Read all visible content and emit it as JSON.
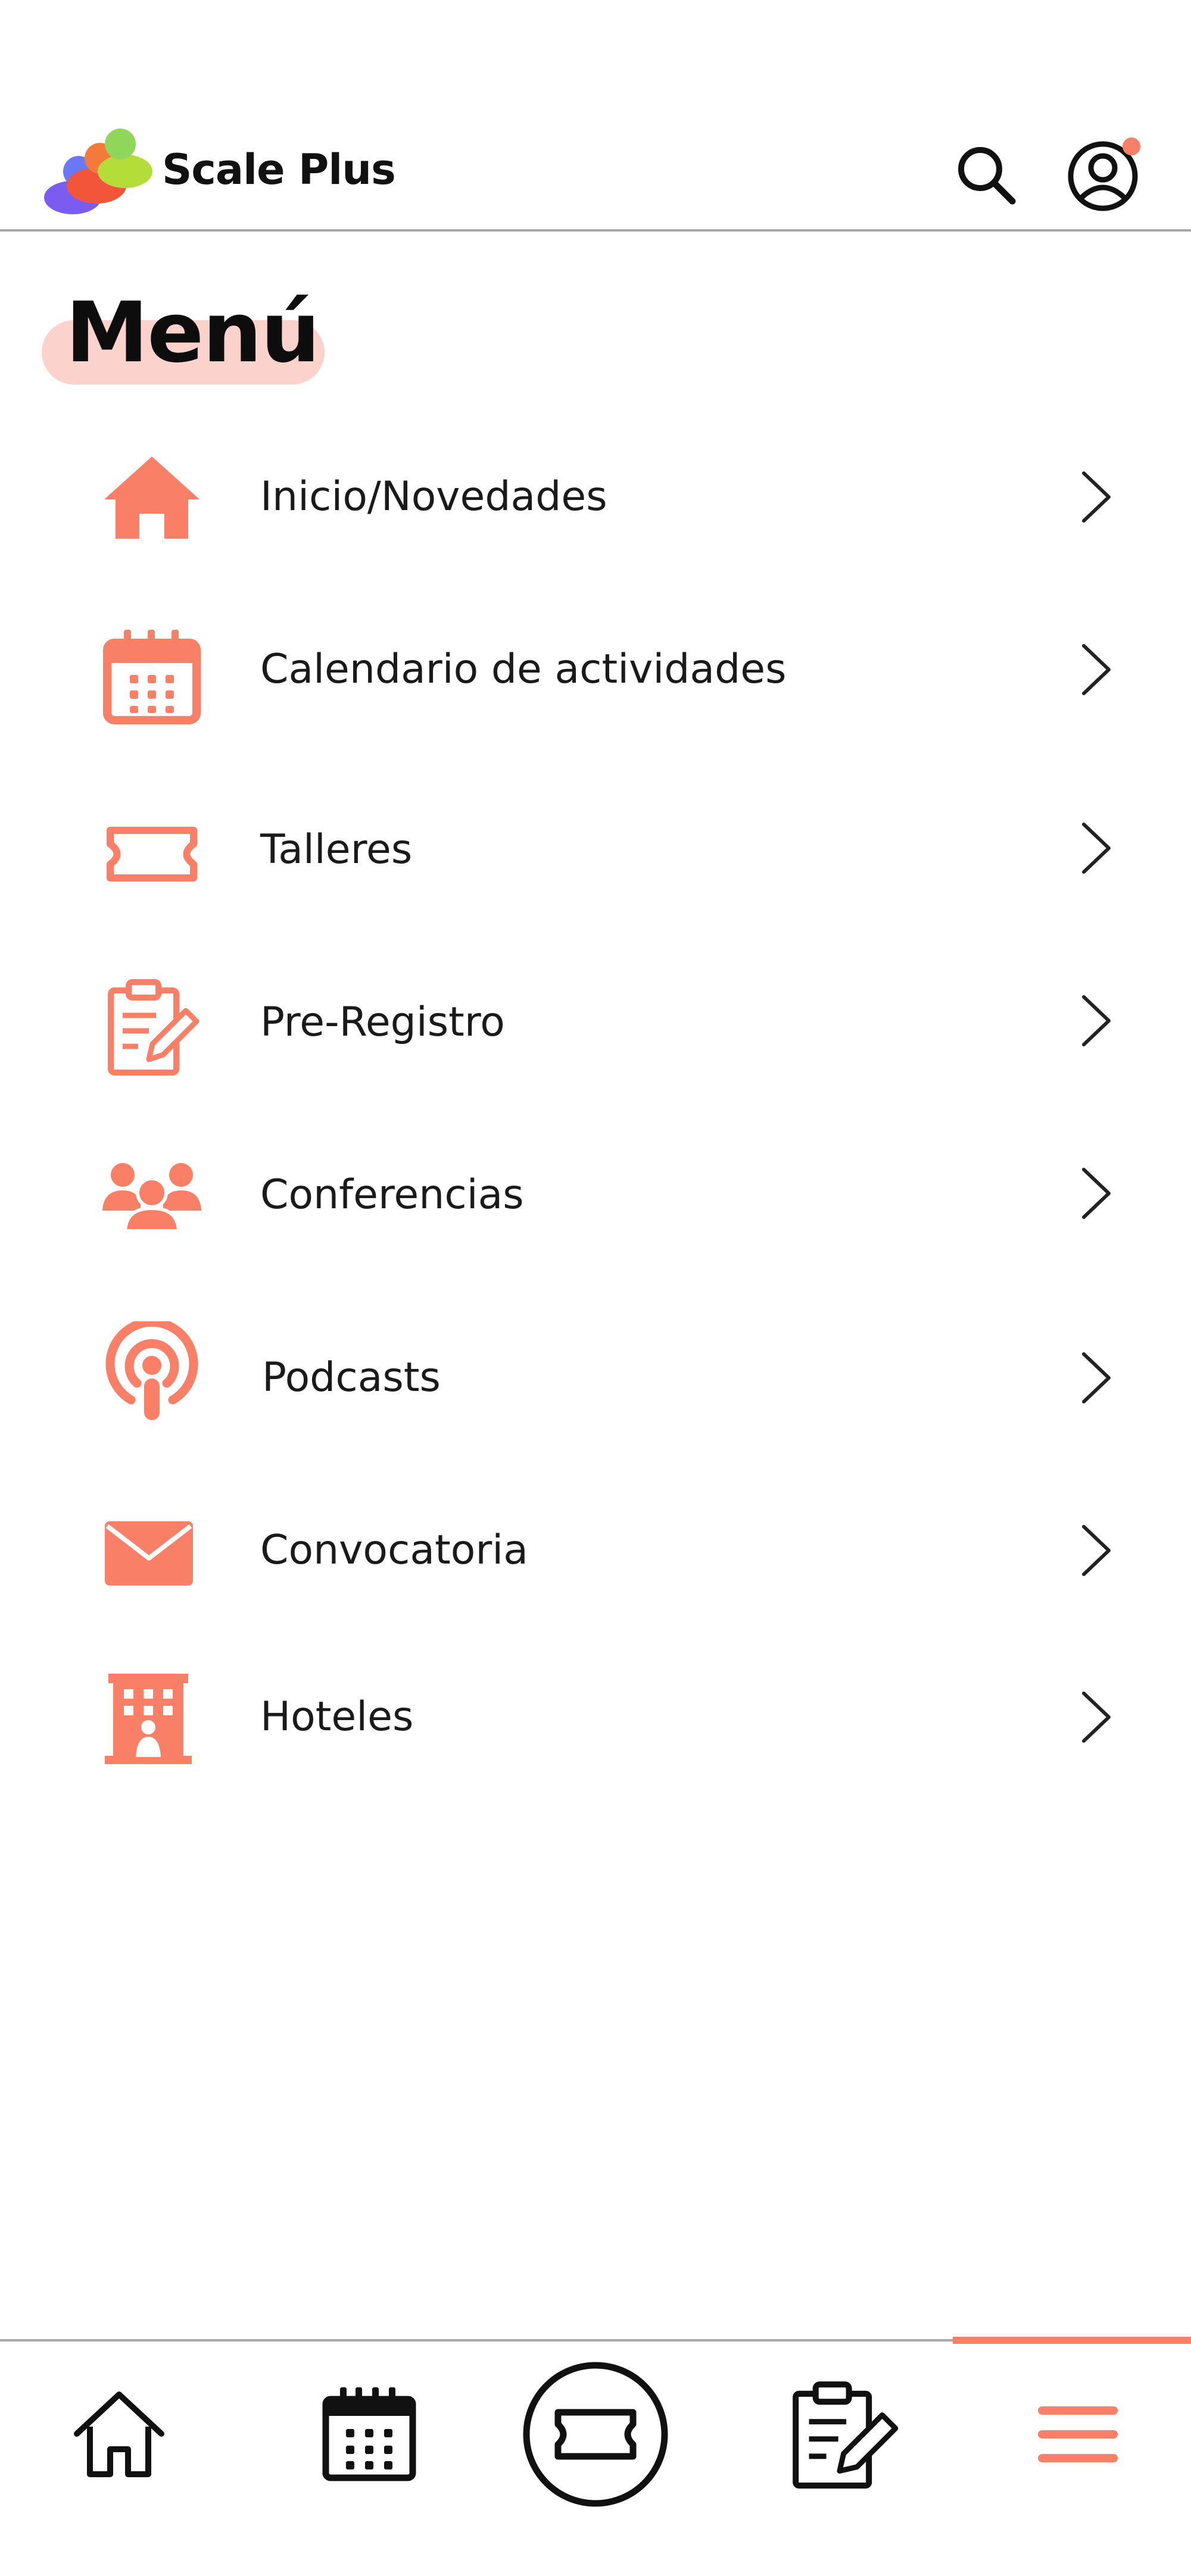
{
  "app": {
    "name": "Scale Plus"
  },
  "header": {
    "search_icon": "search-icon",
    "profile_icon": "user-circle-icon",
    "notification_color": "#f98066"
  },
  "page": {
    "title": "Menú"
  },
  "menu": {
    "items": [
      {
        "label": "Inicio/Novedades",
        "icon": "home-icon"
      },
      {
        "label": "Calendario de actividades",
        "icon": "calendar-icon"
      },
      {
        "label": "Talleres",
        "icon": "ticket-icon"
      },
      {
        "label": "Pre-Registro",
        "icon": "clipboard-edit-icon"
      },
      {
        "label": "Conferencias",
        "icon": "users-group-icon"
      },
      {
        "label": "Podcasts",
        "icon": "podcast-icon"
      },
      {
        "label": "Convocatoria",
        "icon": "envelope-icon"
      },
      {
        "label": "Hoteles",
        "icon": "hotel-icon"
      }
    ]
  },
  "bottom_nav": {
    "items": [
      {
        "icon": "home-icon",
        "active": false
      },
      {
        "icon": "calendar-icon",
        "active": false
      },
      {
        "icon": "ticket-icon",
        "active": false
      },
      {
        "icon": "clipboard-edit-icon",
        "active": false
      },
      {
        "icon": "hamburger-menu-icon",
        "active": true
      }
    ]
  },
  "colors": {
    "accent": "#f98066",
    "highlight": "#fcd2cc",
    "text": "#1a1a1a",
    "divider": "#a8a8a8"
  }
}
